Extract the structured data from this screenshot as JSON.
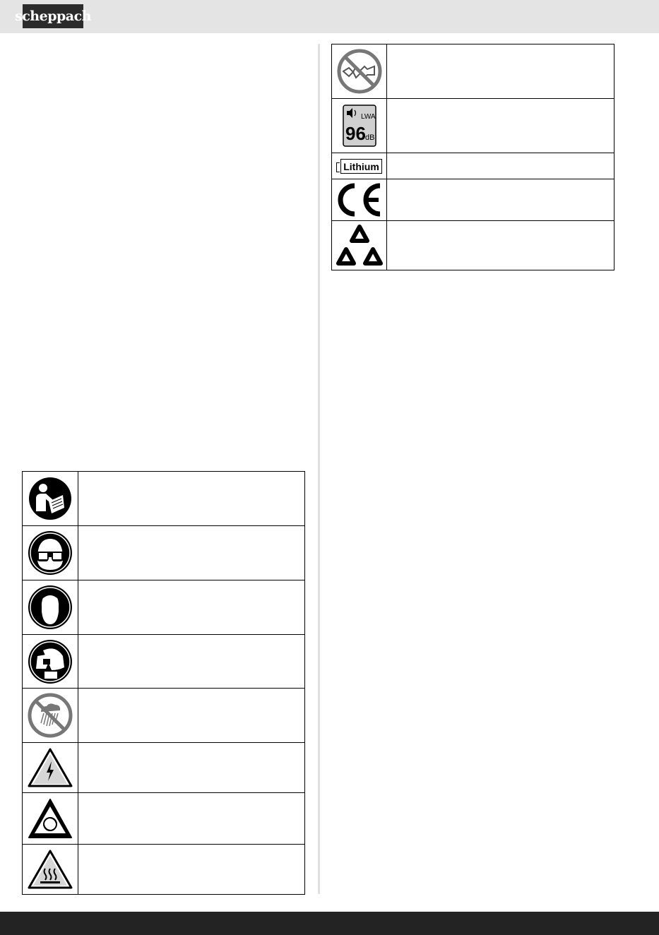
{
  "header": {
    "brand": "scheppach"
  },
  "left_symbols": [
    {
      "icon": "read-manual-icon",
      "description": ""
    },
    {
      "icon": "safety-goggles-icon",
      "description": ""
    },
    {
      "icon": "ear-protection-icon",
      "description": ""
    },
    {
      "icon": "respiratory-mask-icon",
      "description": ""
    },
    {
      "icon": "no-rain-icon",
      "description": ""
    },
    {
      "icon": "electric-shock-warning-icon",
      "description": ""
    },
    {
      "icon": "rotating-parts-warning-icon",
      "description": ""
    },
    {
      "icon": "hot-surface-warning-icon",
      "description": ""
    }
  ],
  "right_symbols": [
    {
      "icon": "no-chain-saw-use-icon",
      "description": ""
    },
    {
      "icon": "sound-power-level-icon",
      "label_lwa": "LWA",
      "label_value": "96",
      "label_unit": "dB",
      "description": ""
    },
    {
      "icon": "lithium-battery-icon",
      "label": "Lithium",
      "description": ""
    },
    {
      "icon": "ce-mark-icon",
      "description": ""
    },
    {
      "icon": "recycling-icon",
      "description": ""
    }
  ]
}
